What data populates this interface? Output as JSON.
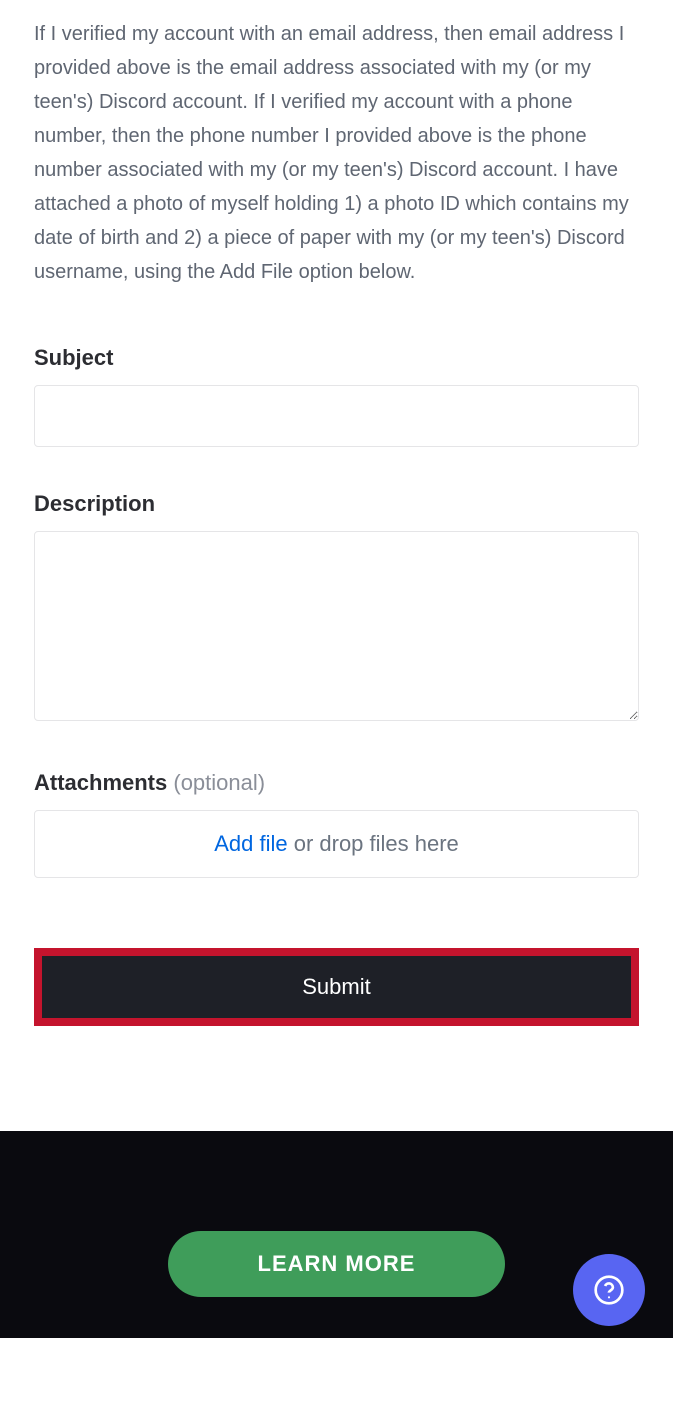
{
  "intro": "If I verified my account with an email address, then email address I provided above is the email address associated with my (or my teen's) Discord account. If I verified my account with a phone number, then the phone number I provided above is the phone number associated with my (or my teen's) Discord account. I have attached a photo of myself holding 1) a photo ID which contains my date of birth and 2) a piece of paper with my (or my teen's) Discord username, using the Add File option below.",
  "fields": {
    "subject": {
      "label": "Subject",
      "value": ""
    },
    "description": {
      "label": "Description",
      "value": ""
    },
    "attachments": {
      "label": "Attachments",
      "optional_suffix": "(optional)",
      "add_file_label": "Add file",
      "drop_text": " or drop files here"
    }
  },
  "submit_label": "Submit",
  "footer": {
    "learn_more_label": "LEARN MORE"
  }
}
